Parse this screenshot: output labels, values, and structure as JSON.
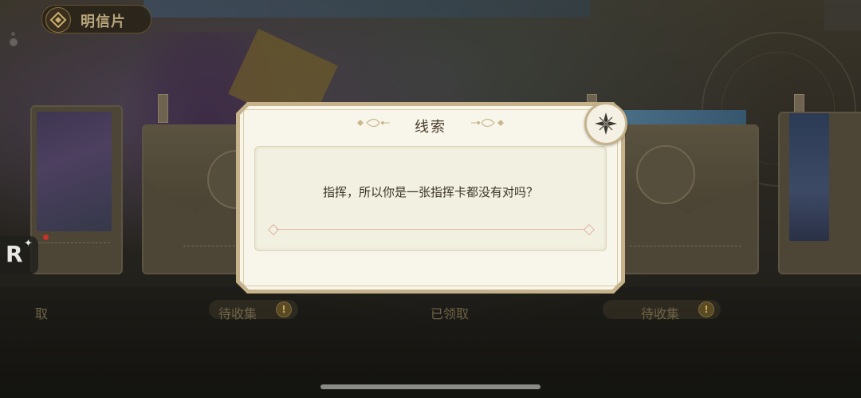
{
  "header": {
    "title": "明信片",
    "back_icon": "back-arrow-icon"
  },
  "cards_status": [
    {
      "label": "取",
      "badge": ""
    },
    {
      "label": "待收集",
      "badge": "!"
    },
    {
      "label": "已领取",
      "badge": ""
    },
    {
      "label": "待收集",
      "badge": "!"
    }
  ],
  "modal": {
    "title": "线索",
    "text": "指挥，所以你是一张指挥卡都没有对吗？",
    "close_icon": "close-icon"
  },
  "overlay_logo": {
    "letter": "R",
    "star": "✦"
  },
  "colors": {
    "modal_bg": "#f8f6ea",
    "modal_border": "#c6b38c",
    "status_text": "#6f6447"
  }
}
